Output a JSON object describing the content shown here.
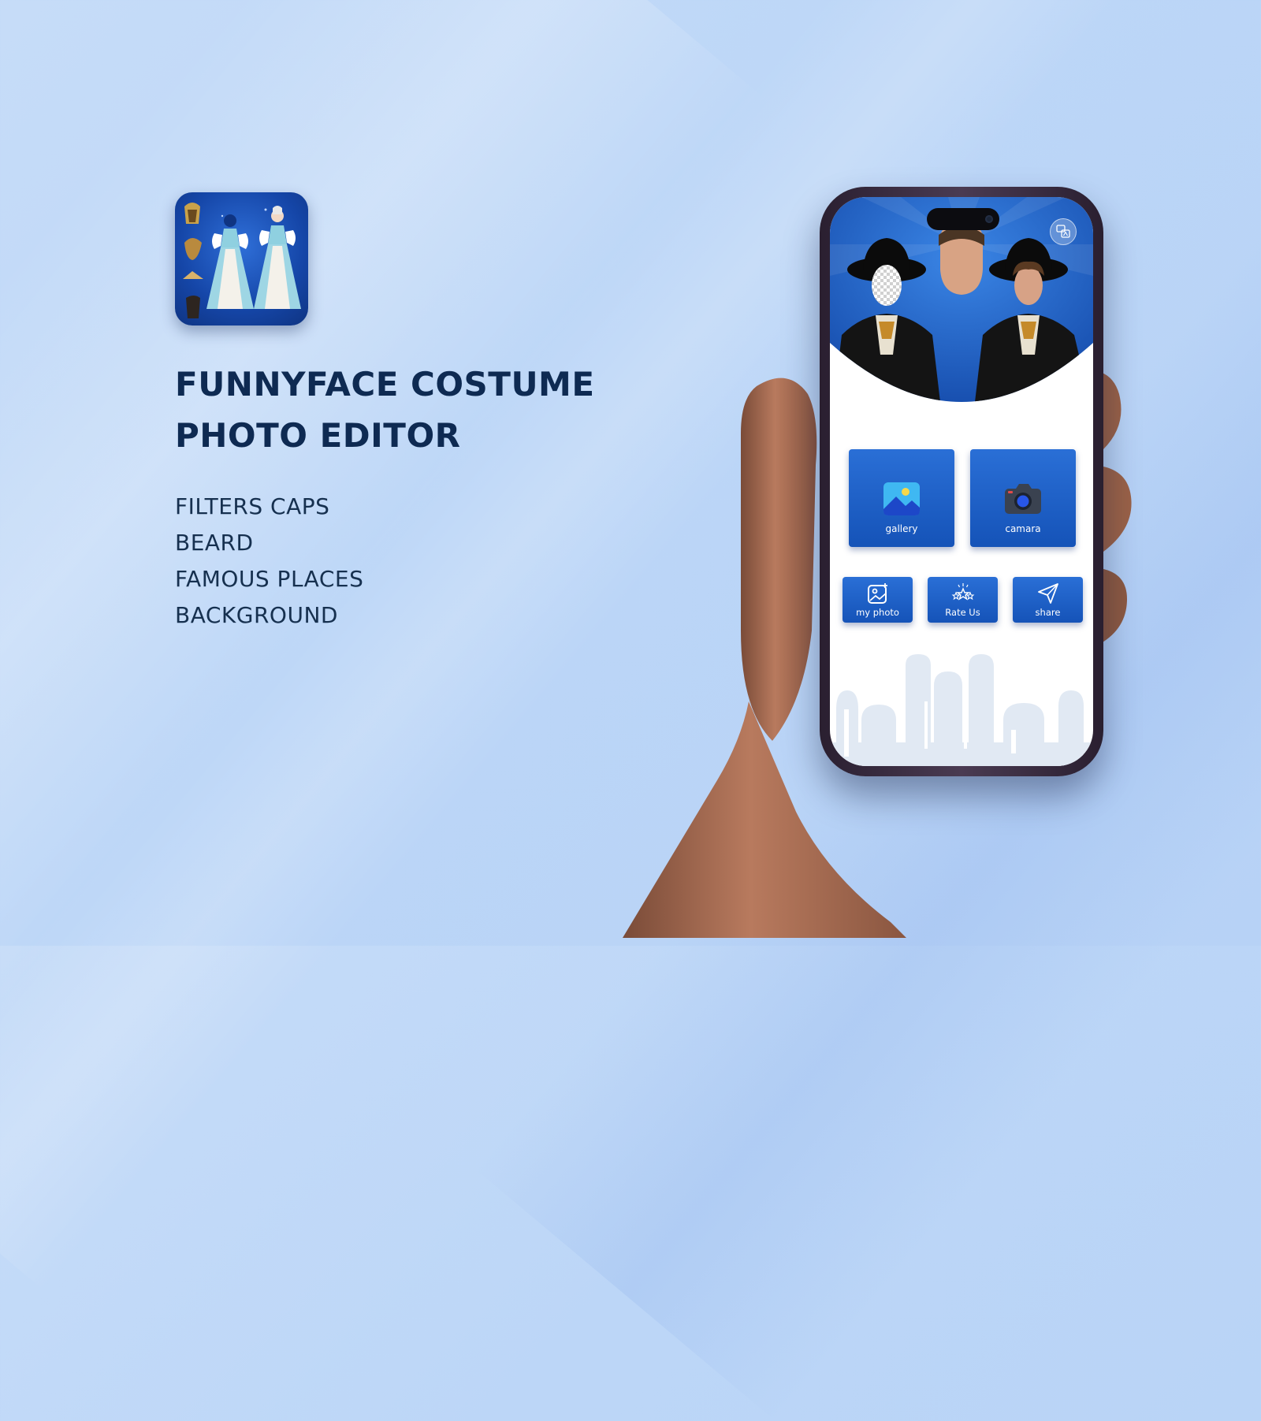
{
  "app": {
    "title": "FUNNYFACE COSTUME PHOTO EDITOR",
    "features": [
      "FILTERS CAPS",
      "BEARD",
      "FAMOUS PLACES",
      "BACKGROUND"
    ]
  },
  "phone_screen": {
    "main_buttons": {
      "gallery_label": "gallery",
      "camera_label": "camara"
    },
    "secondary_buttons": {
      "my_photo_label": "my photo",
      "rate_label": "Rate Us",
      "share_label": "share"
    }
  },
  "icons": {
    "translate": "translate-icon",
    "gallery": "gallery-icon",
    "camera": "camera-icon",
    "my_photo": "my-photo-icon",
    "rate": "star-icon",
    "share": "send-icon"
  },
  "colors": {
    "brand_blue": "#1553b8",
    "title_navy": "#0e2a52",
    "background": "#bcd6f7"
  }
}
